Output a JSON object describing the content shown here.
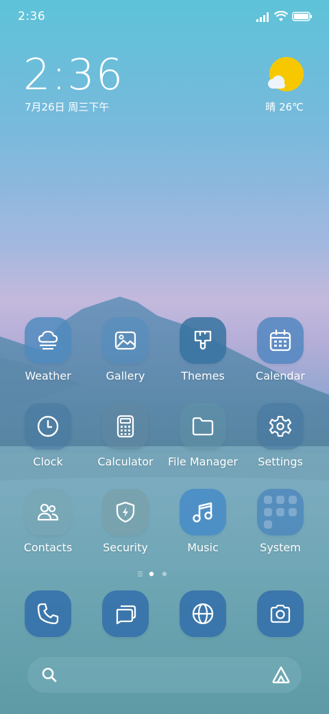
{
  "status_bar": {
    "time": "2:36",
    "icons": [
      "signal-icon",
      "wifi-icon",
      "battery-icon"
    ]
  },
  "clock_widget": {
    "time": "2:36",
    "date": "7月26日 周三下午"
  },
  "weather_widget": {
    "condition_text": "晴",
    "temperature": "26℃",
    "display": "晴 26℃",
    "icon": "sun-cloud-icon"
  },
  "apps": [
    {
      "name": "Weather",
      "icon": "weather-icon"
    },
    {
      "name": "Gallery",
      "icon": "gallery-icon"
    },
    {
      "name": "Themes",
      "icon": "themes-brush-icon"
    },
    {
      "name": "Calendar",
      "icon": "calendar-icon"
    },
    {
      "name": "Clock",
      "icon": "clock-icon"
    },
    {
      "name": "Calculator",
      "icon": "calculator-icon"
    },
    {
      "name": "File Manager",
      "icon": "folder-icon"
    },
    {
      "name": "Settings",
      "icon": "gear-icon"
    },
    {
      "name": "Contacts",
      "icon": "contacts-icon"
    },
    {
      "name": "Security",
      "icon": "shield-icon"
    },
    {
      "name": "Music",
      "icon": "music-note-icon"
    },
    {
      "name": "System",
      "icon": "app-folder-icon"
    }
  ],
  "page_indicator": {
    "pages": 2,
    "current": 1
  },
  "dock": [
    {
      "icon": "phone-icon"
    },
    {
      "icon": "messages-icon"
    },
    {
      "icon": "browser-globe-icon"
    },
    {
      "icon": "camera-icon"
    }
  ],
  "search_bar": {
    "left_icon": "search-icon",
    "right_icon": "assistant-icon"
  },
  "colors": {
    "icon_bg": "#4e8abe",
    "sun": "#f7c800",
    "text": "#ffffff"
  }
}
